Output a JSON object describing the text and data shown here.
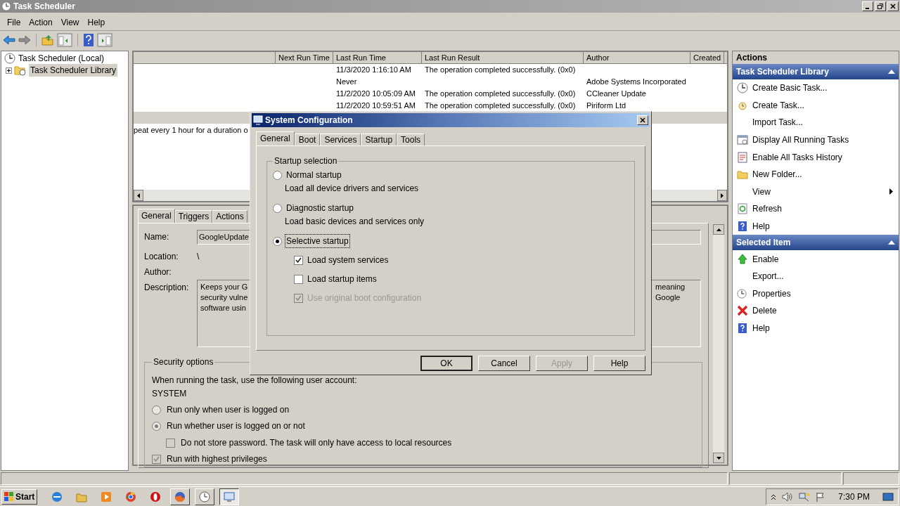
{
  "window": {
    "title": "Task Scheduler"
  },
  "menu": [
    "File",
    "Action",
    "View",
    "Help"
  ],
  "tree": [
    {
      "label": "Task Scheduler (Local)",
      "selected": false,
      "children": [
        {
          "label": "Task Scheduler Library",
          "selected": true,
          "expanded": false
        }
      ]
    }
  ],
  "task_list": {
    "columns": [
      "Next Run Time",
      "Last Run Time",
      "Last Run Result",
      "Author",
      "Created"
    ],
    "rows": [
      {
        "selected": false,
        "last_run_time": "11/3/2020 1:16:10 AM",
        "last_run_result": "The operation completed successfully. (0x0)"
      },
      {
        "selected": false,
        "last_run_time": "Never",
        "author": "Adobe Systems Incorporated"
      },
      {
        "selected": false,
        "last_run_time": "11/2/2020 10:05:09 AM",
        "last_run_result": "The operation completed successfully. (0x0)",
        "author": "CCleaner Update"
      },
      {
        "selected": false,
        "last_run_time": "11/2/2020 10:59:51 AM",
        "last_run_result": "The operation completed successfully. (0x0)",
        "author": "Piriform Ltd"
      },
      {
        "selected": true
      }
    ],
    "trigger_text": "peat every 1 hour for a duration o"
  },
  "details": {
    "tabs": [
      {
        "label": "General",
        "selected": true
      },
      {
        "label": "Triggers",
        "selected": false
      },
      {
        "label": "Actions",
        "selected": false
      }
    ],
    "name_label": "Name:",
    "name_value": "GoogleUpdate",
    "location_label": "Location:",
    "location_value": "\\",
    "author_label": "Author:",
    "description_label": "Description:",
    "description_left": [
      "Keeps your G",
      "security vulne",
      "software usin"
    ],
    "description_right": [
      "meaning",
      "Google"
    ],
    "security": {
      "title": "Security options",
      "account_prompt": "When running the task, use the following user account:",
      "account": "SYSTEM",
      "options": [
        {
          "kind": "radio",
          "label": "Run only when user is logged on",
          "selected": false,
          "disabled": true
        },
        {
          "kind": "radio",
          "label": "Run whether user is logged on or not",
          "selected": true,
          "disabled": true,
          "children": [
            {
              "kind": "checkbox",
              "label": "Do not store password.  The task will only have access to local resources",
              "checked": false,
              "disabled": true
            }
          ]
        },
        {
          "kind": "checkbox",
          "label": "Run with highest privileges",
          "checked": true,
          "disabled": true
        }
      ]
    }
  },
  "actions": {
    "title": "Actions",
    "sections": [
      {
        "title": "Task Scheduler Library",
        "expanded": true,
        "items": [
          {
            "label": "Create Basic Task...",
            "kind": "action"
          },
          {
            "label": "Create Task...",
            "kind": "action"
          },
          {
            "label": "Import Task...",
            "kind": "action"
          },
          {
            "label": "Display All Running Tasks",
            "kind": "action"
          },
          {
            "label": "Enable All Tasks History",
            "kind": "action"
          },
          {
            "label": "New Folder...",
            "kind": "action"
          },
          {
            "label": "View",
            "kind": "submenu"
          },
          {
            "label": "Refresh",
            "kind": "action"
          },
          {
            "label": "Help",
            "kind": "action"
          }
        ]
      },
      {
        "title": "Selected Item",
        "expanded": true,
        "items": [
          {
            "label": "Enable",
            "kind": "action"
          },
          {
            "label": "Export...",
            "kind": "action"
          },
          {
            "label": "Properties",
            "kind": "action"
          },
          {
            "label": "Delete",
            "kind": "action"
          },
          {
            "label": "Help",
            "kind": "action"
          }
        ]
      }
    ]
  },
  "dialog": {
    "title": "System Configuration",
    "tabs": [
      {
        "label": "General",
        "selected": true
      },
      {
        "label": "Boot",
        "selected": false
      },
      {
        "label": "Services",
        "selected": false
      },
      {
        "label": "Startup",
        "selected": false
      },
      {
        "label": "Tools",
        "selected": false
      }
    ],
    "group_title": "Startup selection",
    "options": [
      {
        "label": "Normal startup",
        "description": "Load all device drivers and services",
        "selected": false,
        "focused": false
      },
      {
        "label": "Diagnostic startup",
        "description": "Load basic devices and services only",
        "selected": false,
        "focused": false
      },
      {
        "label": "Selective startup",
        "selected": true,
        "focused": true,
        "children": [
          {
            "label": "Load system services",
            "checked": true,
            "disabled": false
          },
          {
            "label": "Load startup items",
            "checked": false,
            "disabled": false
          },
          {
            "label": "Use original boot configuration",
            "checked": true,
            "disabled": true
          }
        ]
      }
    ],
    "buttons": [
      {
        "label": "OK",
        "default": true,
        "disabled": false
      },
      {
        "label": "Cancel",
        "default": false,
        "disabled": false
      },
      {
        "label": "Apply",
        "default": false,
        "disabled": true
      },
      {
        "label": "Help",
        "default": false,
        "disabled": false
      }
    ]
  },
  "taskbar": {
    "start": "Start",
    "buttons": [
      {
        "kind": "launcher"
      },
      {
        "kind": "launcher"
      },
      {
        "kind": "launcher"
      },
      {
        "kind": "launcher"
      },
      {
        "kind": "launcher"
      },
      {
        "kind": "window",
        "active": false
      },
      {
        "kind": "window",
        "active": false
      },
      {
        "kind": "window",
        "active": true
      }
    ],
    "clock": "7:30 PM"
  }
}
